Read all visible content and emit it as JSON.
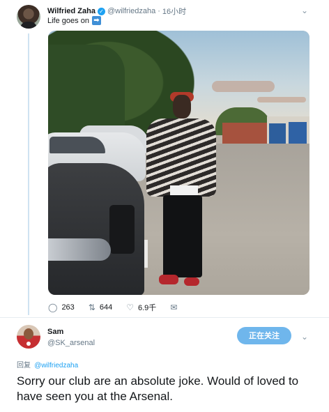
{
  "tweet": {
    "author_name": "Wilfried Zaha",
    "verified_symbol": "✓",
    "author_handle": "@wilfriedzaha",
    "separator": "·",
    "time": "16小时",
    "text": "Life goes on",
    "emoji": "➡",
    "replies_count": "263",
    "retweets_count": "644",
    "likes_count": "6.9千",
    "icons": {
      "reply": "comment-icon",
      "retweet": "retweet-icon",
      "like": "heart-icon",
      "dm": "mail-icon",
      "menu": "chevron-down-icon"
    },
    "icon_glyphs": {
      "reply": "◯",
      "retweet": "⇅",
      "like": "♡",
      "dm": "✉",
      "menu": "⌄"
    }
  },
  "reply": {
    "author_name": "Sam",
    "author_handle": "@SK_arsenal",
    "follow_label": "正在关注",
    "reply_prefix": "回复",
    "reply_mention": "@wilfriedzaha",
    "text": "Sorry our club are an absolute joke. Would of loved to have seen you at the Arsenal.",
    "menu_glyph": "⌄"
  },
  "colors": {
    "accent": "#1da1f2",
    "follow_button": "#6fb6ec",
    "thread_line": "#cfe3f2"
  }
}
